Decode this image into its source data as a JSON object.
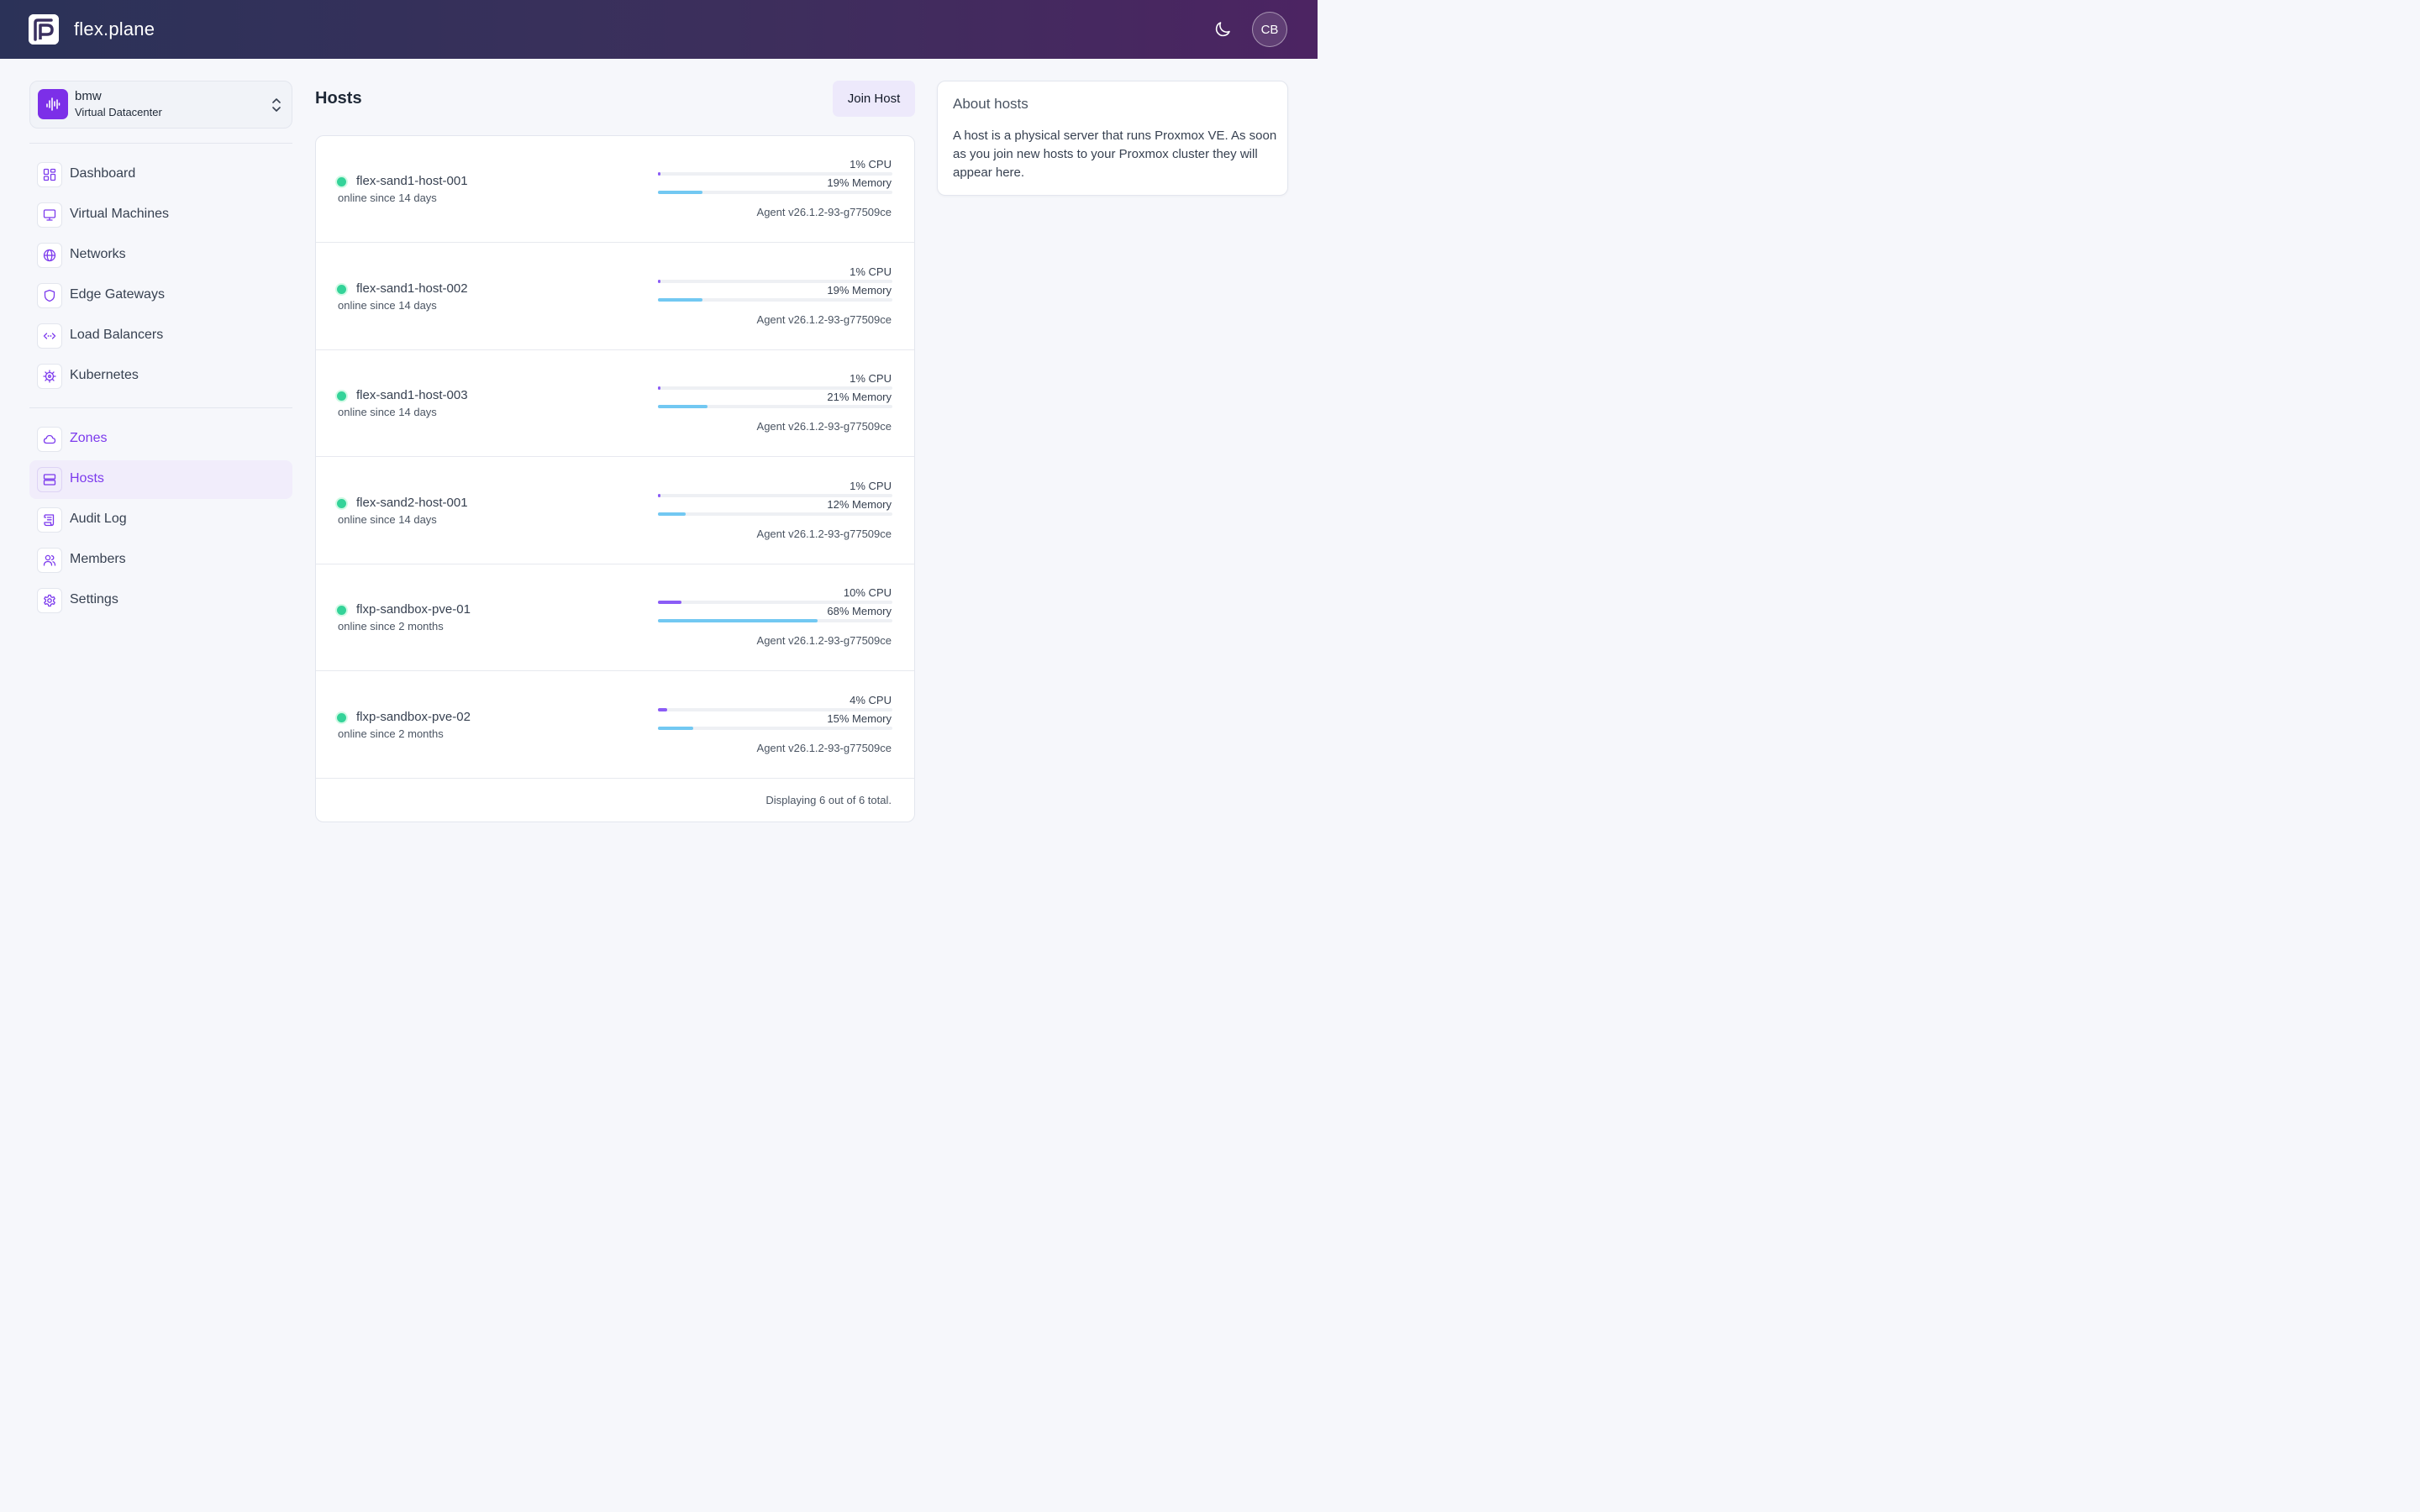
{
  "app": {
    "brand": "flex.plane",
    "avatar_initials": "CB"
  },
  "org": {
    "name": "bmw",
    "subtitle": "Virtual Datacenter"
  },
  "sidebar": {
    "primary": [
      {
        "label": "Dashboard",
        "icon": "dashboard-icon"
      },
      {
        "label": "Virtual Machines",
        "icon": "monitor-icon"
      },
      {
        "label": "Networks",
        "icon": "globe-icon"
      },
      {
        "label": "Edge Gateways",
        "icon": "shield-icon"
      },
      {
        "label": "Load Balancers",
        "icon": "code-arrows-icon"
      },
      {
        "label": "Kubernetes",
        "icon": "helm-icon"
      }
    ],
    "secondary": [
      {
        "label": "Zones",
        "icon": "cloud-icon"
      },
      {
        "label": "Hosts",
        "icon": "server-icon",
        "active": true
      },
      {
        "label": "Audit Log",
        "icon": "scroll-icon"
      },
      {
        "label": "Members",
        "icon": "users-icon"
      },
      {
        "label": "Settings",
        "icon": "gear-icon"
      }
    ]
  },
  "main": {
    "title": "Hosts",
    "join_button": "Join Host",
    "footer": "Displaying 6 out of 6 total.",
    "hosts": [
      {
        "name": "flex-sand1-host-001",
        "since": "online since 14 days",
        "cpu_label": "1% CPU",
        "cpu": 1,
        "mem_label": "19% Memory",
        "mem": 19,
        "agent": "Agent v26.1.2-93-g77509ce"
      },
      {
        "name": "flex-sand1-host-002",
        "since": "online since 14 days",
        "cpu_label": "1% CPU",
        "cpu": 1,
        "mem_label": "19% Memory",
        "mem": 19,
        "agent": "Agent v26.1.2-93-g77509ce"
      },
      {
        "name": "flex-sand1-host-003",
        "since": "online since 14 days",
        "cpu_label": "1% CPU",
        "cpu": 1,
        "mem_label": "21% Memory",
        "mem": 21,
        "agent": "Agent v26.1.2-93-g77509ce"
      },
      {
        "name": "flex-sand2-host-001",
        "since": "online since 14 days",
        "cpu_label": "1% CPU",
        "cpu": 1,
        "mem_label": "12% Memory",
        "mem": 12,
        "agent": "Agent v26.1.2-93-g77509ce"
      },
      {
        "name": "flxp-sandbox-pve-01",
        "since": "online since 2 months",
        "cpu_label": "10% CPU",
        "cpu": 10,
        "mem_label": "68% Memory",
        "mem": 68,
        "agent": "Agent v26.1.2-93-g77509ce"
      },
      {
        "name": "flxp-sandbox-pve-02",
        "since": "online since 2 months",
        "cpu_label": "4% CPU",
        "cpu": 4,
        "mem_label": "15% Memory",
        "mem": 15,
        "agent": "Agent v26.1.2-93-g77509ce"
      }
    ]
  },
  "about": {
    "title": "About hosts",
    "text": "A host is a physical server that runs Proxmox VE. As soon as you join new hosts to your Proxmox cluster they will appear here."
  },
  "colors": {
    "accent": "#7c3aed",
    "cpu_bar": "#8b5cf6",
    "mem_bar": "#72c8f2",
    "status_online": "#34d399"
  }
}
